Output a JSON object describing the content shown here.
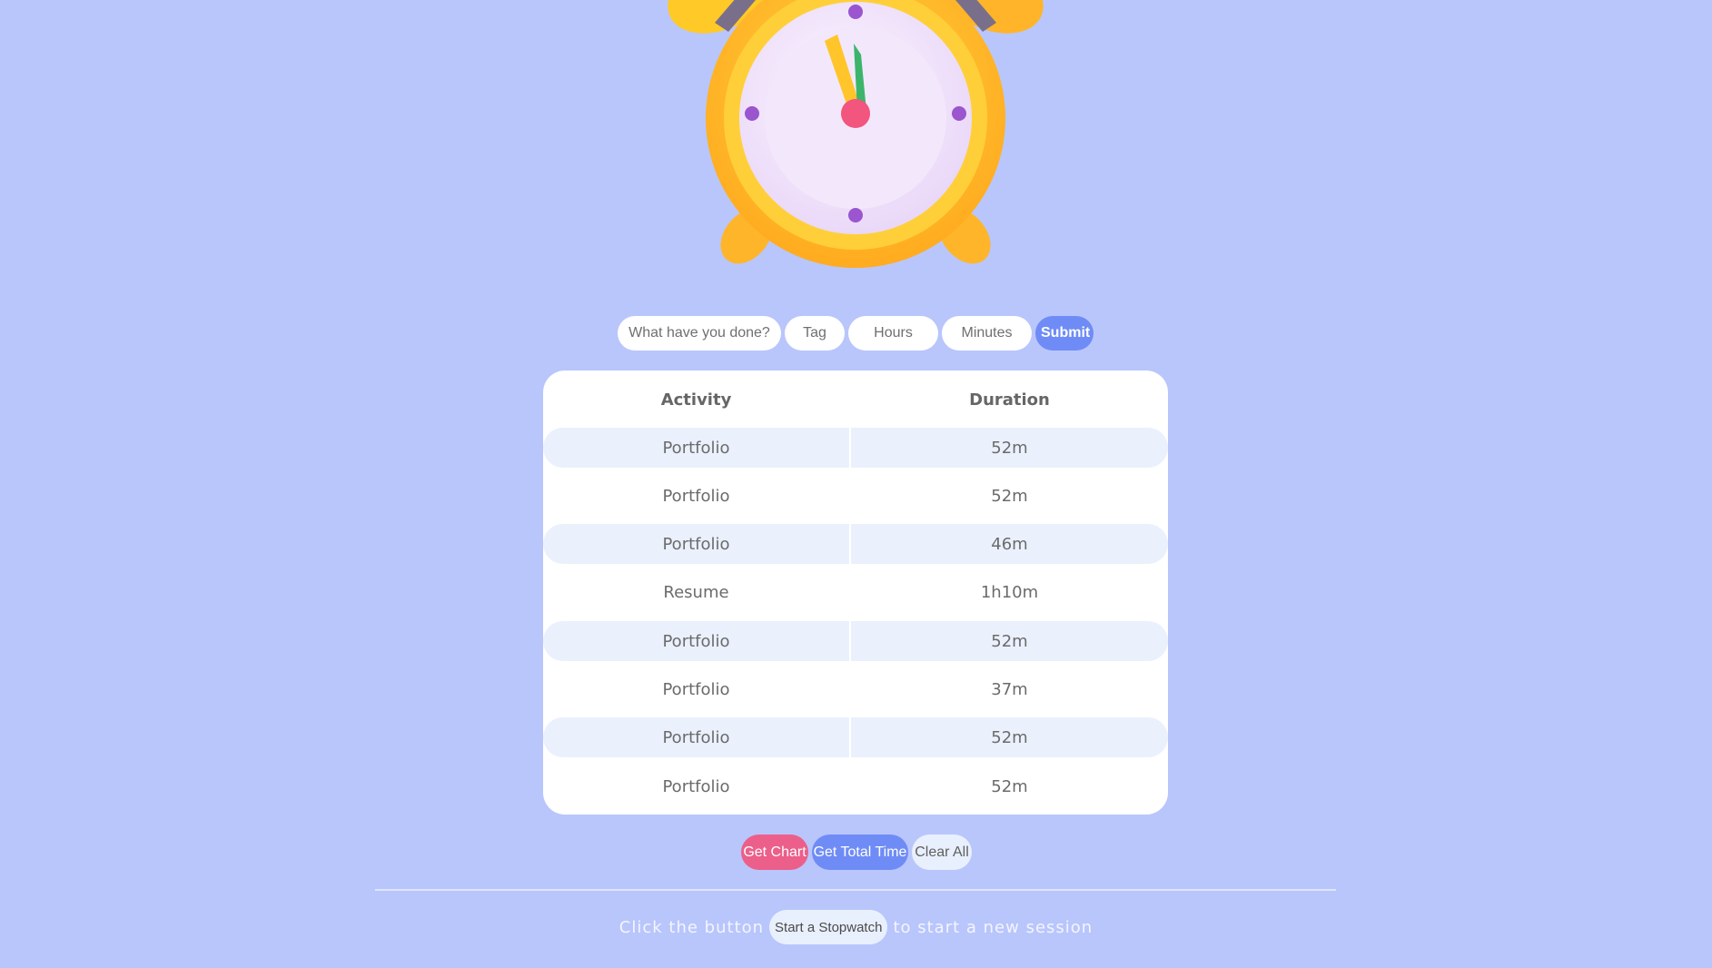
{
  "entry_form": {
    "activity_placeholder": "What have you done?",
    "tag_placeholder": "Tag",
    "hours_placeholder": "Hours",
    "minutes_placeholder": "Minutes",
    "submit_label": "Submit"
  },
  "table": {
    "headers": [
      "Activity",
      "Duration"
    ],
    "rows": [
      {
        "activity": "Portfolio",
        "duration": "52m"
      },
      {
        "activity": "Portfolio",
        "duration": "52m"
      },
      {
        "activity": "Portfolio",
        "duration": "46m"
      },
      {
        "activity": "Resume",
        "duration": "1h10m"
      },
      {
        "activity": "Portfolio",
        "duration": "52m"
      },
      {
        "activity": "Portfolio",
        "duration": "37m"
      },
      {
        "activity": "Portfolio",
        "duration": "52m"
      },
      {
        "activity": "Portfolio",
        "duration": "52m"
      }
    ]
  },
  "actions": {
    "get_chart_label": "Get Chart",
    "get_total_label": "Get Total Time",
    "clear_all_label": "Clear All"
  },
  "footer": {
    "prefix": "Click the button",
    "button_label": "Start a Stopwatch",
    "suffix": "to start a new session"
  },
  "colors": {
    "background": "#b9c6fc",
    "accent_blue": "#6f8cf6",
    "accent_pink": "#ec5f8a",
    "row_stripe": "#eaf1fd"
  },
  "icons": {
    "hero": "alarm-clock-icon"
  }
}
